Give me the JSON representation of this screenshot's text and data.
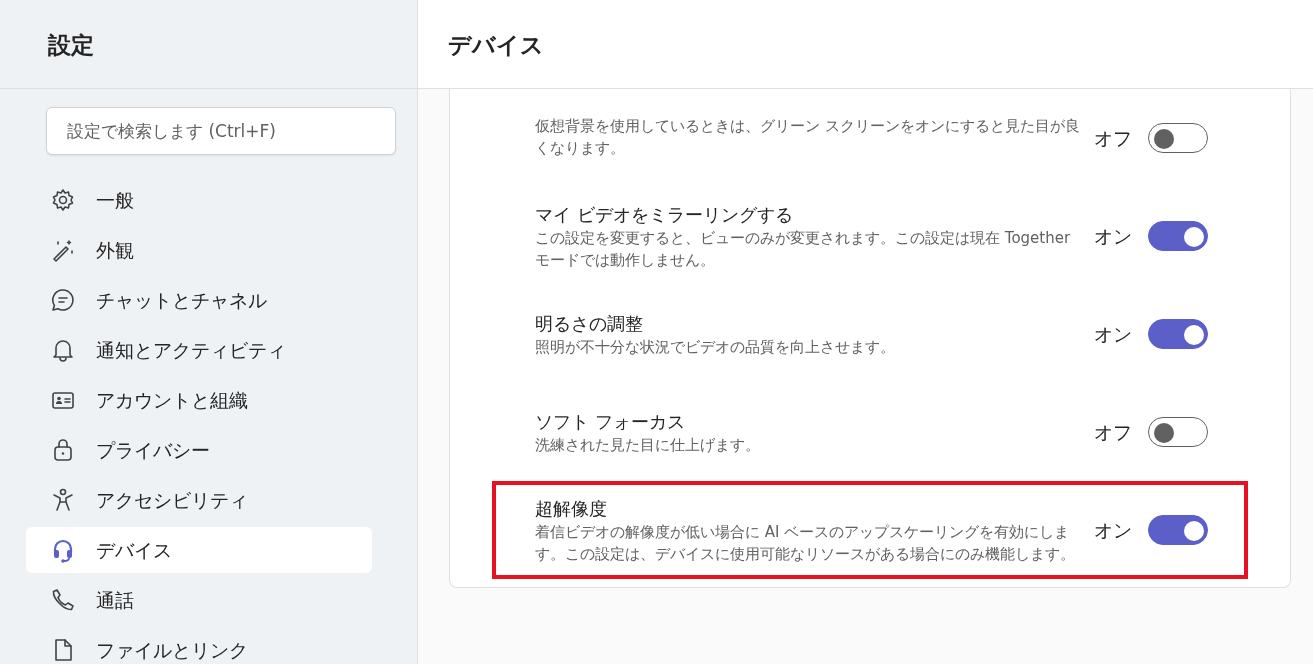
{
  "sidebar": {
    "title": "設定",
    "search": {
      "placeholder": "設定で検索します (Ctrl+F)"
    },
    "items": [
      {
        "label": "一般",
        "selected": false
      },
      {
        "label": "外観",
        "selected": false
      },
      {
        "label": "チャットとチャネル",
        "selected": false
      },
      {
        "label": "通知とアクティビティ",
        "selected": false
      },
      {
        "label": "アカウントと組織",
        "selected": false
      },
      {
        "label": "プライバシー",
        "selected": false
      },
      {
        "label": "アクセシビリティ",
        "selected": false
      },
      {
        "label": "デバイス",
        "selected": true
      },
      {
        "label": "通話",
        "selected": false
      },
      {
        "label": "ファイルとリンク",
        "selected": false
      }
    ]
  },
  "page": {
    "title": "デバイス",
    "settings": [
      {
        "description": "仮想背景を使用しているときは、グリーン スクリーンをオンにすると見た目が良くなります。",
        "state_label": "オフ",
        "on": false,
        "highlighted": false
      },
      {
        "title": "マイ ビデオをミラーリングする",
        "description": "この設定を変更すると、ビューのみが変更されます。この設定は現在 Together モードでは動作しません。",
        "state_label": "オン",
        "on": true,
        "highlighted": false
      },
      {
        "title": "明るさの調整",
        "description": "照明が不十分な状況でビデオの品質を向上させます。",
        "state_label": "オン",
        "on": true,
        "highlighted": false
      },
      {
        "title": "ソフト フォーカス",
        "description": "洗練された見た目に仕上げます。",
        "state_label": "オフ",
        "on": false,
        "highlighted": false
      },
      {
        "title": "超解像度",
        "description": "着信ビデオの解像度が低い場合に AI ベースのアップスケーリングを有効にします。この設定は、デバイスに使用可能なリソースがある場合にのみ機能します。",
        "state_label": "オン",
        "on": true,
        "highlighted": true
      }
    ]
  }
}
